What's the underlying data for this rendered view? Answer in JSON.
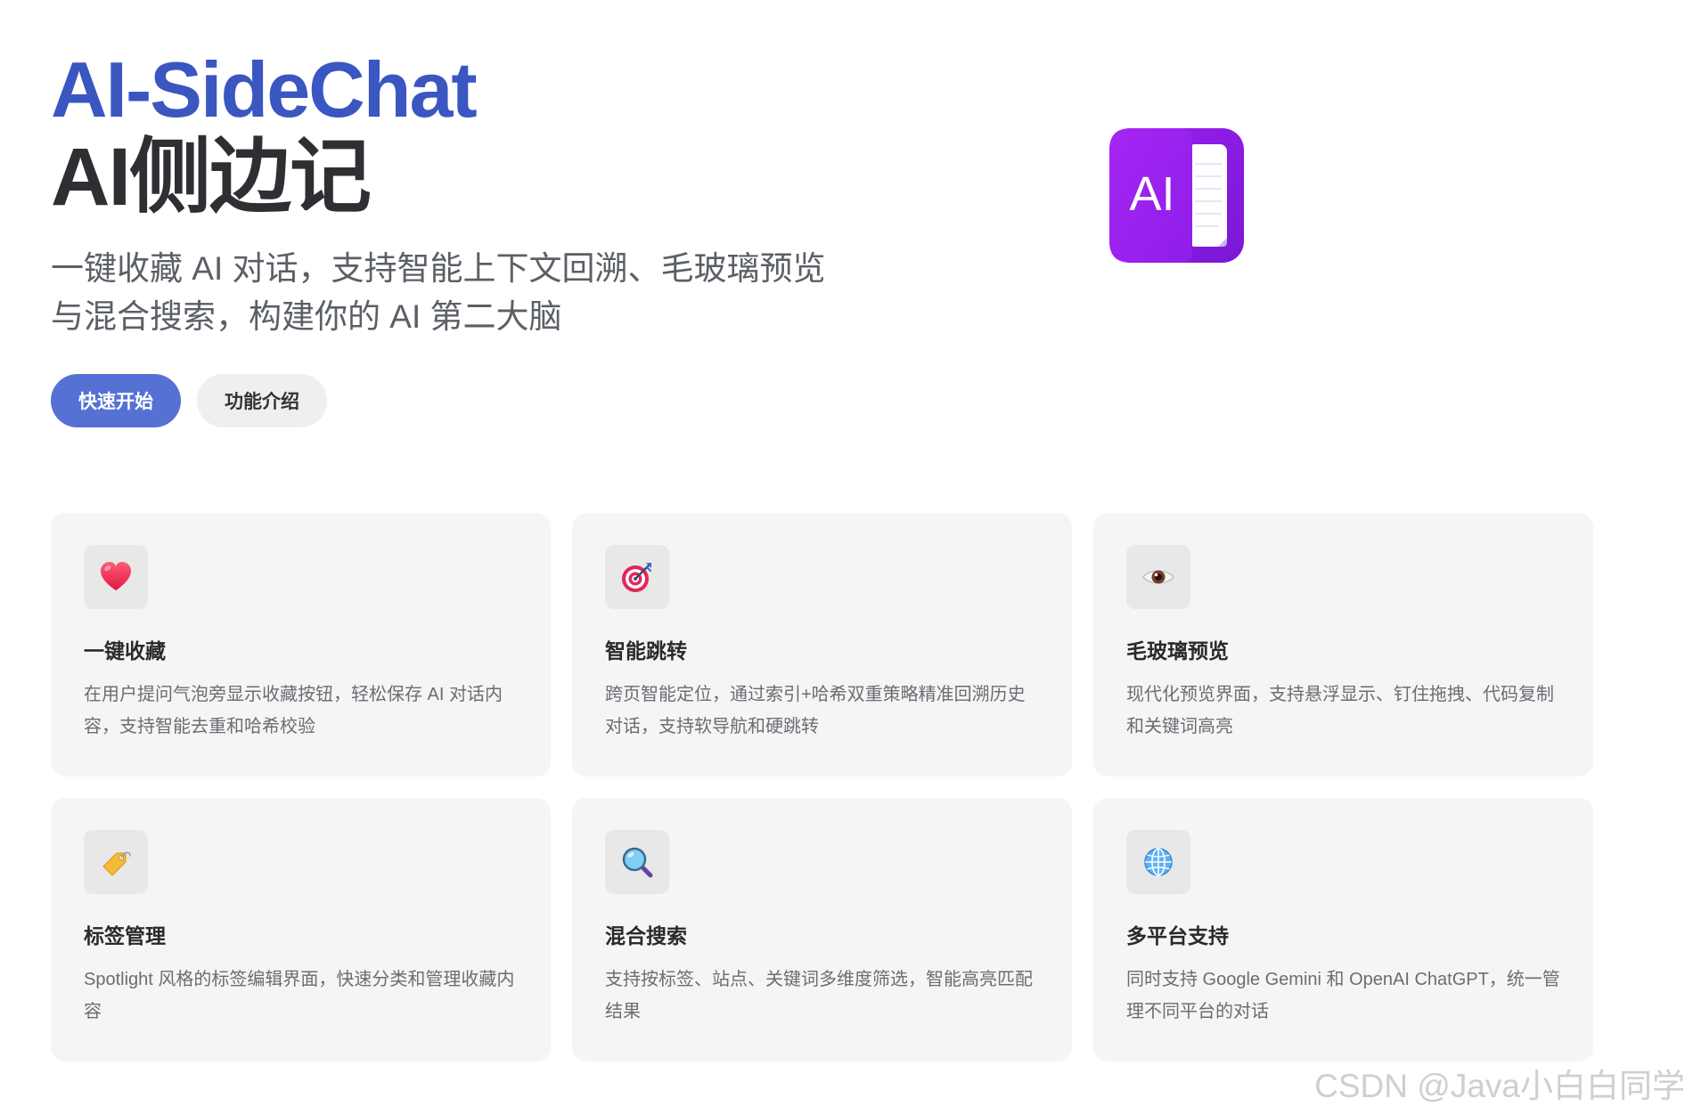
{
  "hero": {
    "title": "AI-SideChat",
    "subtitle": "AI侧边记",
    "description_lines": [
      "一键收藏 AI 对话，支持智能上下文回溯、毛玻璃预览",
      "与混合搜索，构建你的 AI 第二大脑"
    ],
    "primary_button": "快速开始",
    "secondary_button": "功能介绍"
  },
  "logo": {
    "text": "AI",
    "icon": "ai-document-logo-icon",
    "gradient": [
      "#9d1ff0",
      "#7a18d8"
    ]
  },
  "features": [
    {
      "icon": "heart-icon",
      "title": "一键收藏",
      "description": "在用户提问气泡旁显示收藏按钮，轻松保存 AI 对话内容，支持智能去重和哈希校验"
    },
    {
      "icon": "target-icon",
      "title": "智能跳转",
      "description": "跨页智能定位，通过索引+哈希双重策略精准回溯历史对话，支持软导航和硬跳转"
    },
    {
      "icon": "eye-icon",
      "title": "毛玻璃预览",
      "description": "现代化预览界面，支持悬浮显示、钉住拖拽、代码复制和关键词高亮"
    },
    {
      "icon": "tag-icon",
      "title": "标签管理",
      "description": "Spotlight 风格的标签编辑界面，快速分类和管理收藏内容"
    },
    {
      "icon": "magnifier-icon",
      "title": "混合搜索",
      "description": "支持按标签、站点、关键词多维度筛选，智能高亮匹配结果"
    },
    {
      "icon": "globe-icon",
      "title": "多平台支持",
      "description": "同时支持 Google Gemini 和 OpenAI ChatGPT，统一管理不同平台的对话"
    }
  ],
  "watermark": "CSDN @Java小白白同学",
  "colors": {
    "accent": "#3a56c1",
    "primary_button": "#5571d3",
    "card_background": "#f5f5f5"
  }
}
